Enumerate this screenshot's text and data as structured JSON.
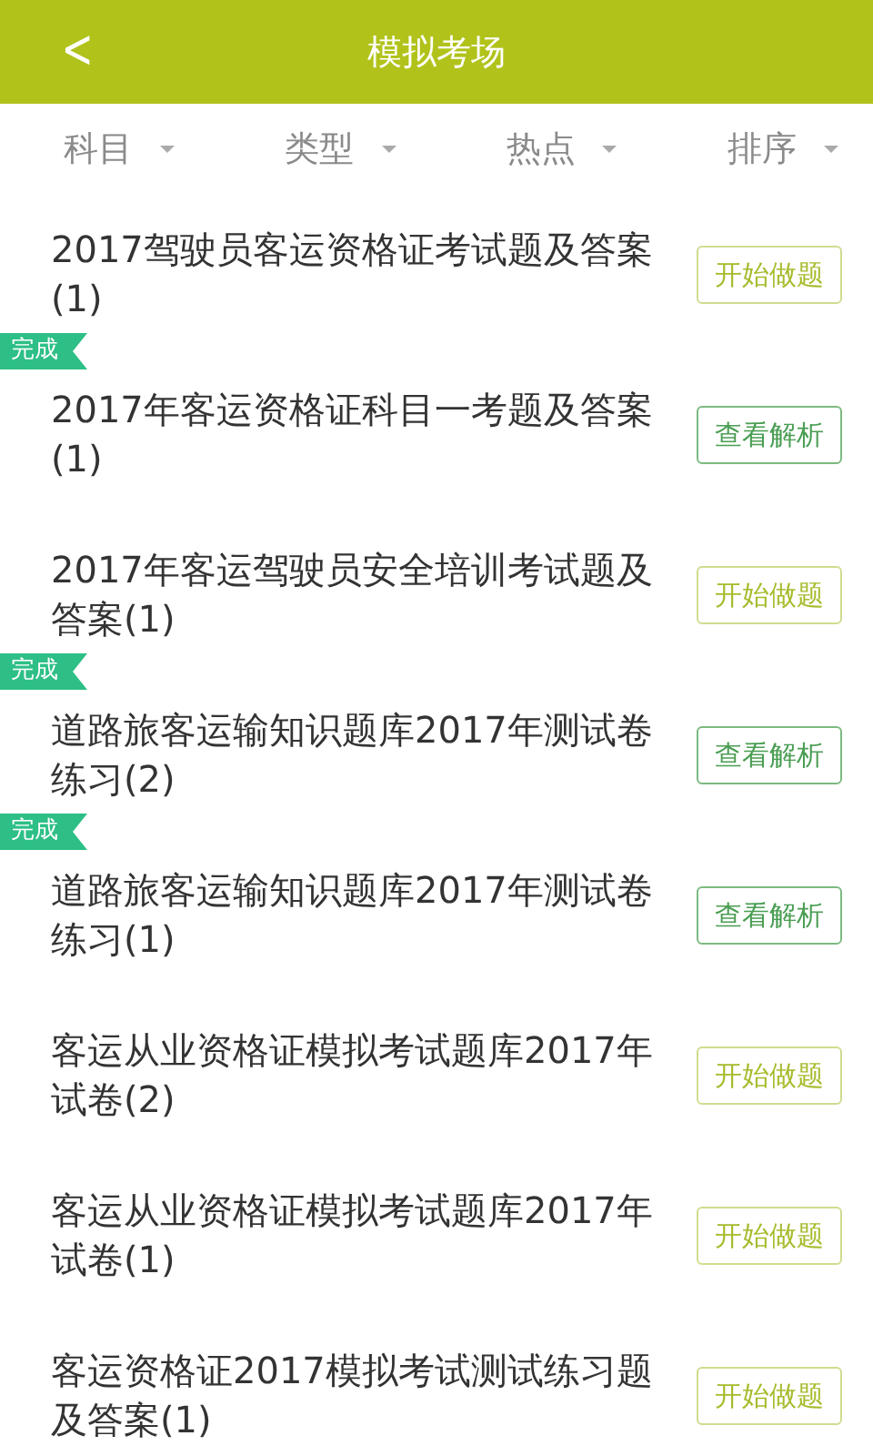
{
  "header": {
    "back": "<",
    "title": "模拟考场"
  },
  "filters": [
    {
      "label": "科目"
    },
    {
      "label": "类型"
    },
    {
      "label": "热点"
    },
    {
      "label": "排序"
    }
  ],
  "exams": [
    {
      "title": "2017驾驶员客运资格证考试题及答案(1)",
      "completed": false,
      "button": {
        "kind": "start",
        "label": "开始做题"
      }
    },
    {
      "title": "2017年客运资格证科目一考题及答案(1)",
      "completed": true,
      "badge": "完成",
      "button": {
        "kind": "review",
        "label": "查看解析"
      }
    },
    {
      "title": "2017年客运驾驶员安全培训考试题及答案(1)",
      "completed": false,
      "button": {
        "kind": "start",
        "label": "开始做题"
      }
    },
    {
      "title": "道路旅客运输知识题库2017年测试卷练习(2)",
      "completed": true,
      "badge": "完成",
      "button": {
        "kind": "review",
        "label": "查看解析"
      }
    },
    {
      "title": "道路旅客运输知识题库2017年测试卷练习(1)",
      "completed": true,
      "badge": "完成",
      "button": {
        "kind": "review",
        "label": "查看解析"
      }
    },
    {
      "title": "客运从业资格证模拟考试题库2017年试卷(2)",
      "completed": false,
      "button": {
        "kind": "start",
        "label": "开始做题"
      }
    },
    {
      "title": "客运从业资格证模拟考试题库2017年试卷(1)",
      "completed": false,
      "button": {
        "kind": "start",
        "label": "开始做题"
      }
    },
    {
      "title": "客运资格证2017模拟考试测试练习题及答案(1)",
      "completed": false,
      "button": {
        "kind": "start",
        "label": "开始做题"
      }
    }
  ]
}
